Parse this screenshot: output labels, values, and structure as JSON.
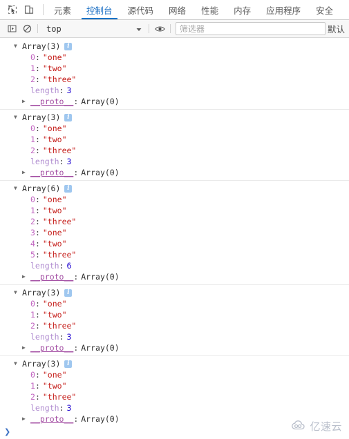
{
  "tabbar": {
    "icons": [
      {
        "name": "inspect-element-icon",
        "glyph": "inspect"
      },
      {
        "name": "device-toolbar-icon",
        "glyph": "device"
      }
    ],
    "tabs": [
      {
        "label": "元素",
        "active": false
      },
      {
        "label": "控制台",
        "active": true
      },
      {
        "label": "源代码",
        "active": false
      },
      {
        "label": "网络",
        "active": false
      },
      {
        "label": "性能",
        "active": false
      },
      {
        "label": "内存",
        "active": false
      },
      {
        "label": "应用程序",
        "active": false
      },
      {
        "label": "安全",
        "active": false
      }
    ]
  },
  "filterbar": {
    "sidebar_toggle_icon": "console-sidebar-icon",
    "clear_icon": "clear-console-icon",
    "context": "top",
    "caret_icon": "chevron-down-icon",
    "eye_icon": "eye-icon",
    "filter_placeholder": "筛选器",
    "filter_value": "",
    "level_label": "默认"
  },
  "console": {
    "groups": [
      {
        "header": "Array(3)",
        "entries": [
          {
            "key": "0",
            "kind": "index",
            "value": "\"one\"",
            "vkind": "string"
          },
          {
            "key": "1",
            "kind": "index",
            "value": "\"two\"",
            "vkind": "string"
          },
          {
            "key": "2",
            "kind": "index",
            "value": "\"three\"",
            "vkind": "string"
          },
          {
            "key": "length",
            "kind": "length",
            "value": "3",
            "vkind": "number"
          }
        ],
        "proto_key": "__proto__",
        "proto_value": "Array(0)"
      },
      {
        "header": "Array(3)",
        "entries": [
          {
            "key": "0",
            "kind": "index",
            "value": "\"one\"",
            "vkind": "string"
          },
          {
            "key": "1",
            "kind": "index",
            "value": "\"two\"",
            "vkind": "string"
          },
          {
            "key": "2",
            "kind": "index",
            "value": "\"three\"",
            "vkind": "string"
          },
          {
            "key": "length",
            "kind": "length",
            "value": "3",
            "vkind": "number"
          }
        ],
        "proto_key": "__proto__",
        "proto_value": "Array(0)"
      },
      {
        "header": "Array(6)",
        "entries": [
          {
            "key": "0",
            "kind": "index",
            "value": "\"one\"",
            "vkind": "string"
          },
          {
            "key": "1",
            "kind": "index",
            "value": "\"two\"",
            "vkind": "string"
          },
          {
            "key": "2",
            "kind": "index",
            "value": "\"three\"",
            "vkind": "string"
          },
          {
            "key": "3",
            "kind": "index",
            "value": "\"one\"",
            "vkind": "string"
          },
          {
            "key": "4",
            "kind": "index",
            "value": "\"two\"",
            "vkind": "string"
          },
          {
            "key": "5",
            "kind": "index",
            "value": "\"three\"",
            "vkind": "string"
          },
          {
            "key": "length",
            "kind": "length",
            "value": "6",
            "vkind": "number"
          }
        ],
        "proto_key": "__proto__",
        "proto_value": "Array(0)"
      },
      {
        "header": "Array(3)",
        "entries": [
          {
            "key": "0",
            "kind": "index",
            "value": "\"one\"",
            "vkind": "string"
          },
          {
            "key": "1",
            "kind": "index",
            "value": "\"two\"",
            "vkind": "string"
          },
          {
            "key": "2",
            "kind": "index",
            "value": "\"three\"",
            "vkind": "string"
          },
          {
            "key": "length",
            "kind": "length",
            "value": "3",
            "vkind": "number"
          }
        ],
        "proto_key": "__proto__",
        "proto_value": "Array(0)"
      },
      {
        "header": "Array(3)",
        "entries": [
          {
            "key": "0",
            "kind": "index",
            "value": "\"one\"",
            "vkind": "string"
          },
          {
            "key": "1",
            "kind": "index",
            "value": "\"two\"",
            "vkind": "string"
          },
          {
            "key": "2",
            "kind": "index",
            "value": "\"three\"",
            "vkind": "string"
          },
          {
            "key": "length",
            "kind": "length",
            "value": "3",
            "vkind": "number"
          }
        ],
        "proto_key": "__proto__",
        "proto_value": "Array(0)"
      }
    ],
    "expanded_triangle": "▼",
    "collapsed_triangle": "▶",
    "info_badge": "i"
  },
  "prompt": {
    "chevron": "❯"
  },
  "watermark": {
    "text": "亿速云",
    "logo_icon": "cloud-logo-icon"
  },
  "colors": {
    "accent": "#1a73c7",
    "string": "#c41a16",
    "number": "#1c00cf",
    "index_key": "#c064c0",
    "proto_key": "#a24ca2",
    "info_badge": "#9fc7ef"
  }
}
